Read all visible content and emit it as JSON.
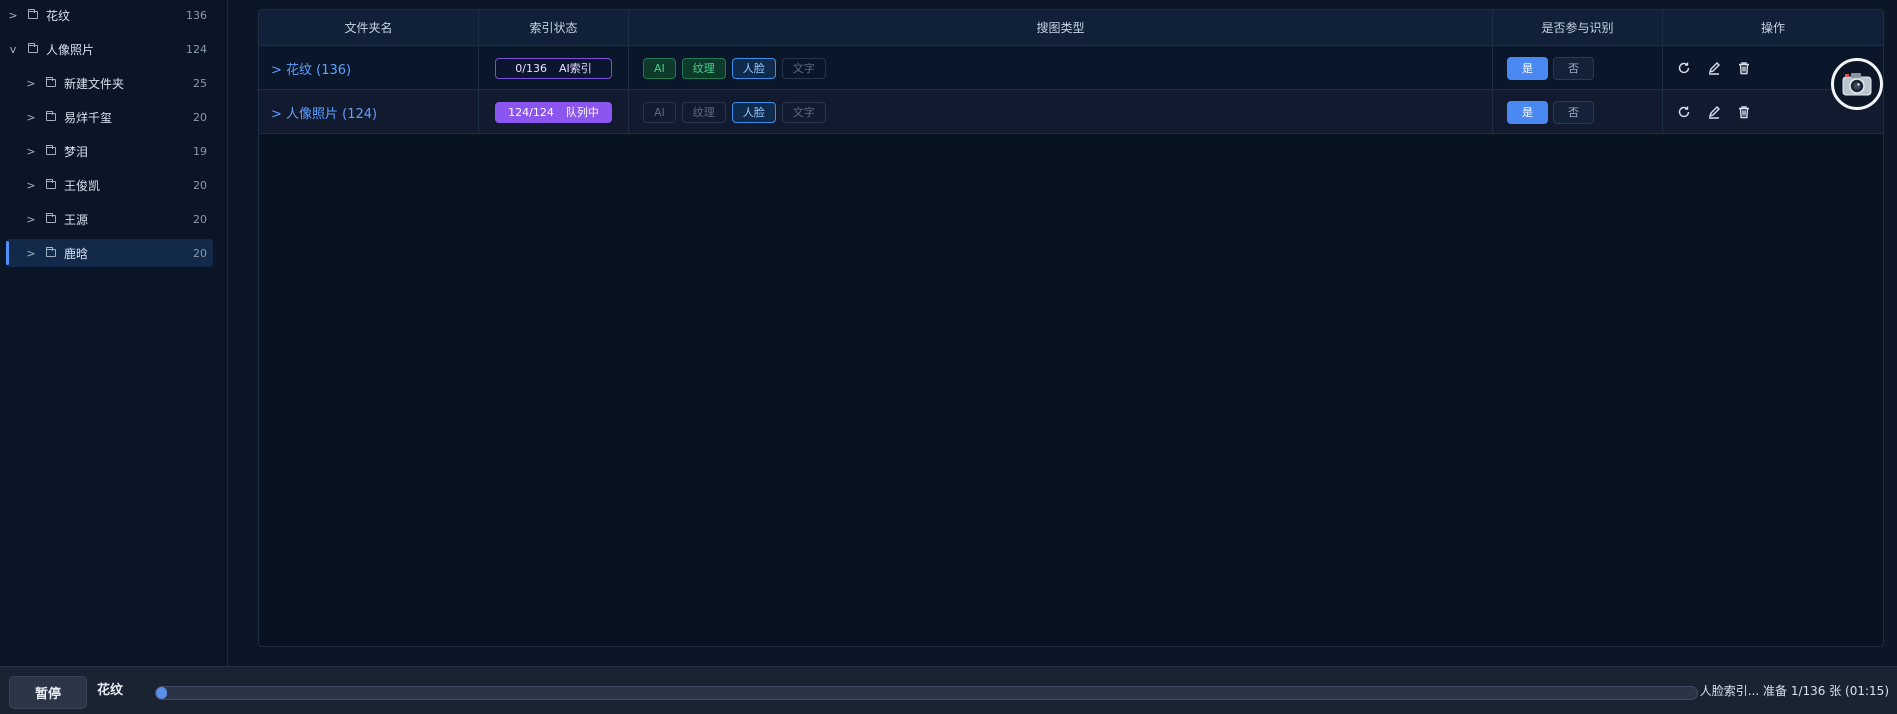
{
  "sidebar": {
    "items": [
      {
        "chev": ">",
        "label": "花纹",
        "count": "136"
      },
      {
        "chev": "v",
        "label": "人像照片",
        "count": "124"
      },
      {
        "chev": ">",
        "label": "新建文件夹",
        "count": "25"
      },
      {
        "chev": ">",
        "label": "易烊千玺",
        "count": "20"
      },
      {
        "chev": ">",
        "label": "梦泪",
        "count": "19"
      },
      {
        "chev": ">",
        "label": "王俊凯",
        "count": "20"
      },
      {
        "chev": ">",
        "label": "王源",
        "count": "20"
      },
      {
        "chev": ">",
        "label": "鹿晗",
        "count": "20"
      }
    ]
  },
  "table": {
    "headers": [
      "文件夹名",
      "索引状态",
      "搜图类型",
      "是否参与识别",
      "操作"
    ],
    "rows": [
      {
        "folder": "> 花纹 (136)",
        "status_progress": "0/136",
        "status_text": "AI索引",
        "tags": [
          "AI",
          "纹理",
          "人脸",
          "文字"
        ],
        "yes": "是",
        "no": "否"
      },
      {
        "folder": "> 人像照片 (124)",
        "status_progress": "124/124",
        "status_text": "队列中",
        "tags": [
          "AI",
          "纹理",
          "人脸",
          "文字"
        ],
        "yes": "是",
        "no": "否"
      }
    ]
  },
  "icons": {
    "refresh": "refresh-icon",
    "edit": "edit-icon",
    "delete": "trash-icon",
    "camera": "camera-icon"
  },
  "bottombar": {
    "pause_label": "暂停",
    "current_folder": "花纹",
    "progress_fraction": 0.007,
    "progress_text": "人脸索引... 准备 1/136 张 (01:15)"
  },
  "colors": {
    "accent": "#4a88f2",
    "status_purple": "#8b55f0",
    "tag_green": "#48d08a",
    "background": "#0b1626"
  }
}
